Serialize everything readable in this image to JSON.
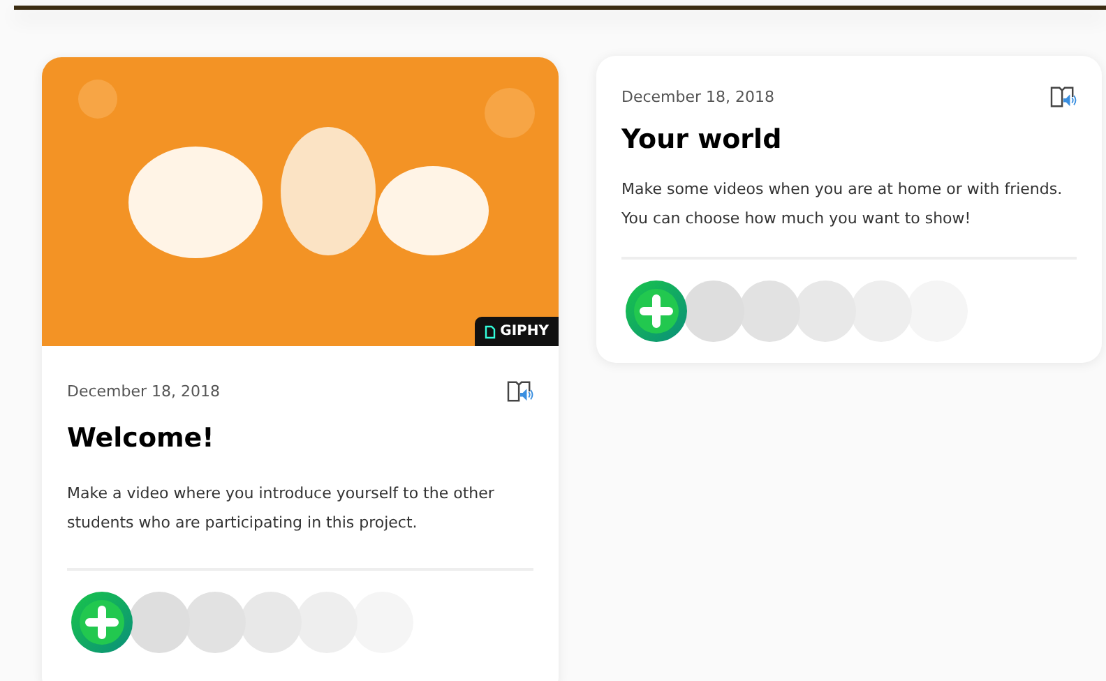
{
  "cards": [
    {
      "image": {
        "badge": "GIPHY"
      },
      "date": "December 18, 2018",
      "title": "Welcome!",
      "description": "Make a video where you introduce yourself to the other students who are participating in this project."
    },
    {
      "date": "December 18, 2018",
      "title": "Your world",
      "description": "Make some videos when you are at home or with friends. You can choose how much you want to show!"
    }
  ]
}
